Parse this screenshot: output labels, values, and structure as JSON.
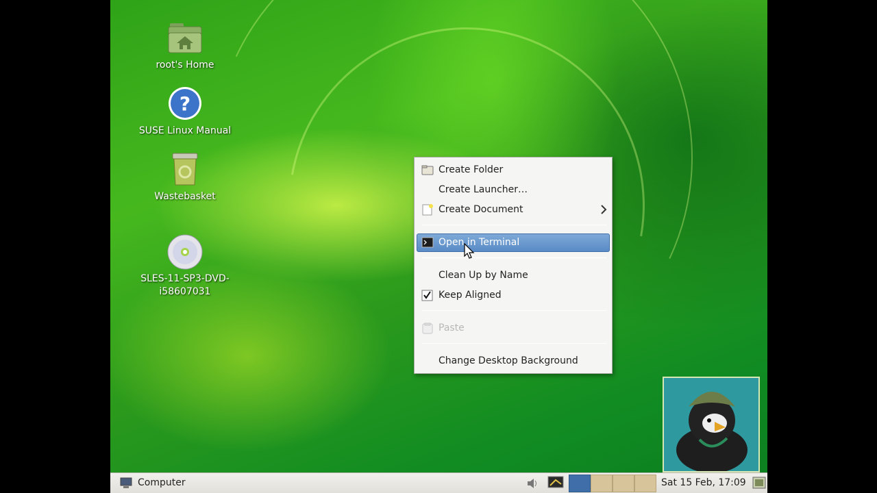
{
  "desktop": {
    "icons": [
      {
        "label": "root's Home",
        "icon": "home-folder-icon"
      },
      {
        "label": "SUSE Linux Manual",
        "icon": "help-icon"
      },
      {
        "label": "Wastebasket",
        "icon": "trash-icon"
      },
      {
        "label": "SLES-11-SP3-DVD-\ni58607031",
        "icon": "dvd-icon"
      }
    ]
  },
  "context_menu": {
    "items": [
      {
        "label": "Create Folder",
        "mnemonic": "F",
        "icon": "folder-icon"
      },
      {
        "label": "Create Launcher…",
        "mnemonic": "L"
      },
      {
        "label": "Create Document",
        "mnemonic": "D",
        "icon": "document-icon",
        "submenu": true
      },
      {
        "label": "Open in Terminal",
        "mnemonic": "T",
        "icon": "terminal-icon",
        "highlighted": true
      },
      {
        "label": "Clean Up by Name",
        "mnemonic": "U"
      },
      {
        "label": "Keep Aligned",
        "mnemonic": "K",
        "checked": true
      },
      {
        "label": "Paste",
        "mnemonic": "P",
        "icon": "paste-icon",
        "disabled": true
      },
      {
        "label": "Change Desktop Background",
        "mnemonic": "B"
      }
    ]
  },
  "panel": {
    "computer_label": "Computer",
    "clock": "Sat 15 Feb, 17:09",
    "workspaces": 4,
    "active_workspace": 1
  },
  "colors": {
    "highlight": "#5a8bc6",
    "panel": "#e9e7e2"
  }
}
